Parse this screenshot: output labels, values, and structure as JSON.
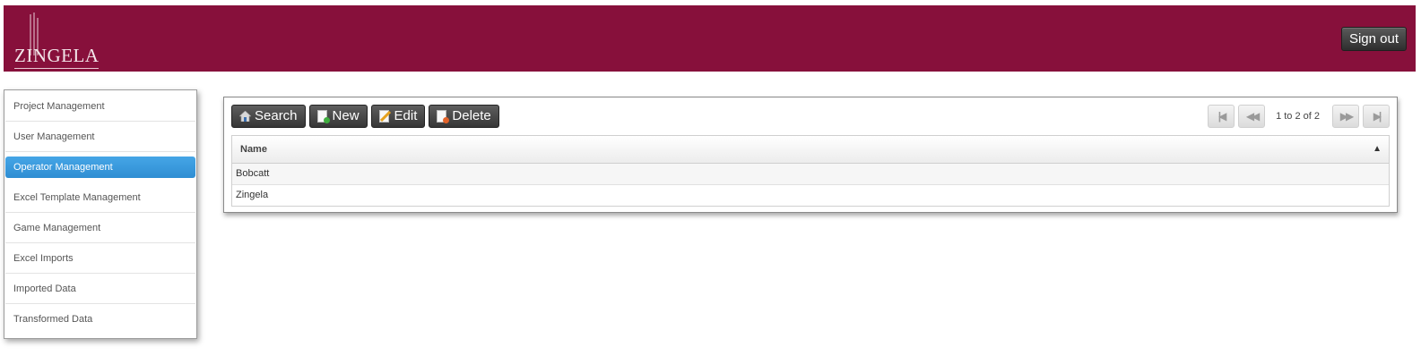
{
  "header": {
    "logo_text": "ZINGELA",
    "signout_label": "Sign out",
    "bg_color": "#87103b"
  },
  "sidebar": {
    "items": [
      {
        "label": "Project Management"
      },
      {
        "label": "User Management"
      },
      {
        "label": "Operator Management"
      },
      {
        "label": "Excel Template Management"
      },
      {
        "label": "Game Management"
      },
      {
        "label": "Excel Imports"
      },
      {
        "label": "Imported Data"
      },
      {
        "label": "Transformed Data"
      }
    ],
    "active_index": 2,
    "accent_color": "#2f8ed3"
  },
  "toolbar": {
    "search_label": "Search",
    "new_label": "New",
    "edit_label": "Edit",
    "delete_label": "Delete",
    "search_icon": "house-search-icon",
    "new_icon": "new-document-icon",
    "edit_icon": "edit-pencil-icon",
    "delete_icon": "delete-document-icon"
  },
  "pager": {
    "info": "1 to 2 of 2",
    "first_icon": "first-page-icon",
    "prev_icon": "previous-page-icon",
    "next_icon": "next-page-icon",
    "last_icon": "last-page-icon"
  },
  "grid": {
    "column_name": "Name",
    "sort": "ascending",
    "rows": [
      {
        "name": "Bobcatt"
      },
      {
        "name": "Zingela"
      }
    ]
  }
}
